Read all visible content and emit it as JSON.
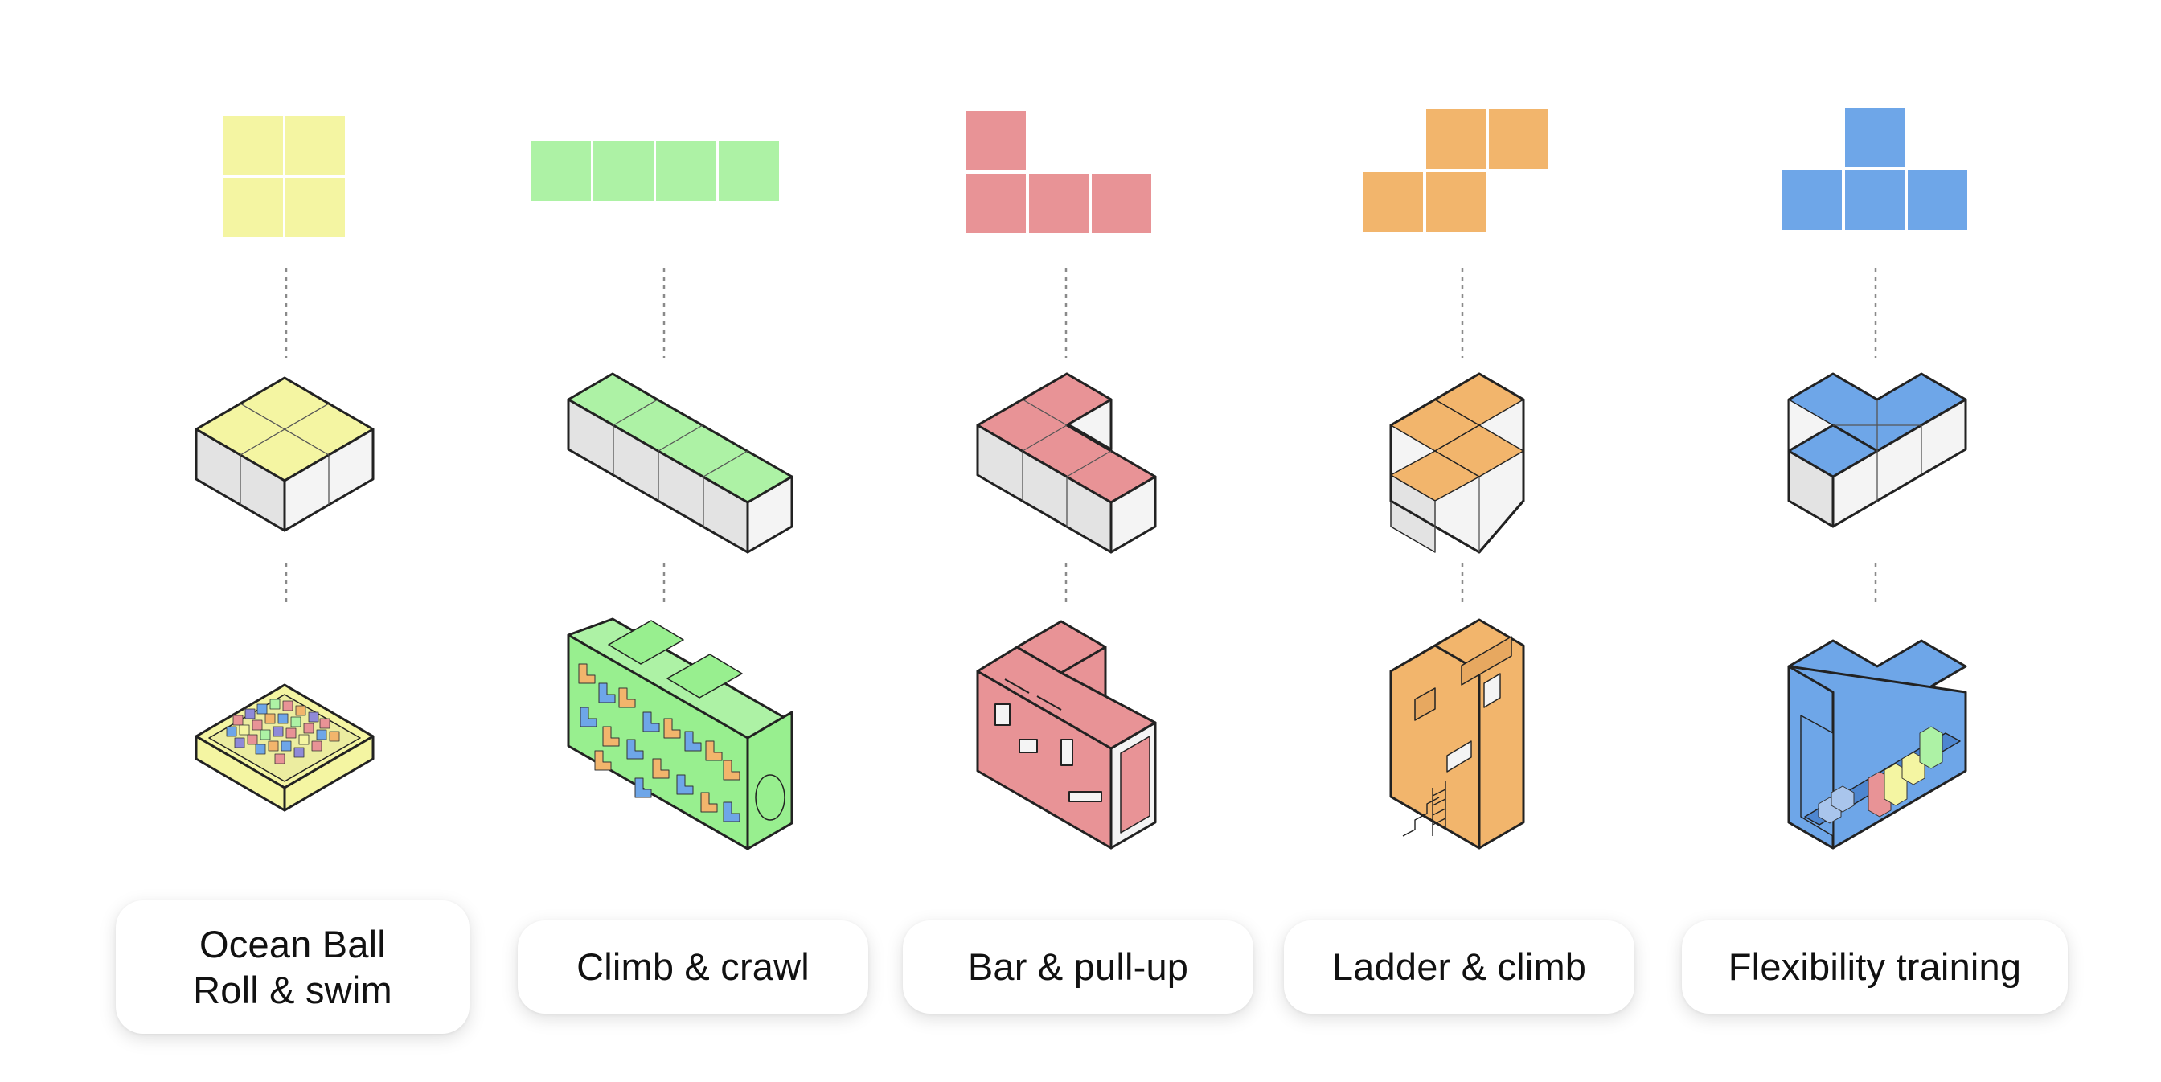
{
  "modules": [
    {
      "id": "ocean-ball",
      "label_lines": [
        "Ocean Ball",
        "Roll & swim"
      ],
      "color": "#f4f5a2",
      "shape": "O-tetromino"
    },
    {
      "id": "climb-crawl",
      "label_lines": [
        "Climb & crawl"
      ],
      "color": "#adf2a5",
      "shape": "I-tetromino"
    },
    {
      "id": "bar-pullup",
      "label_lines": [
        "Bar & pull-up"
      ],
      "color": "#e89396",
      "shape": "L-tetromino"
    },
    {
      "id": "ladder-climb",
      "label_lines": [
        "Ladder & climb"
      ],
      "color": "#f2b56c",
      "shape": "S-tetromino"
    },
    {
      "id": "flexibility",
      "label_lines": [
        "Flexibility training"
      ],
      "color": "#6ea6e8",
      "shape": "T-tetromino"
    }
  ],
  "colors": {
    "outline": "#222222",
    "side_light": "#f5f5f5",
    "side_dark": "#e0e0e0",
    "connector": "#8a8a8a"
  }
}
